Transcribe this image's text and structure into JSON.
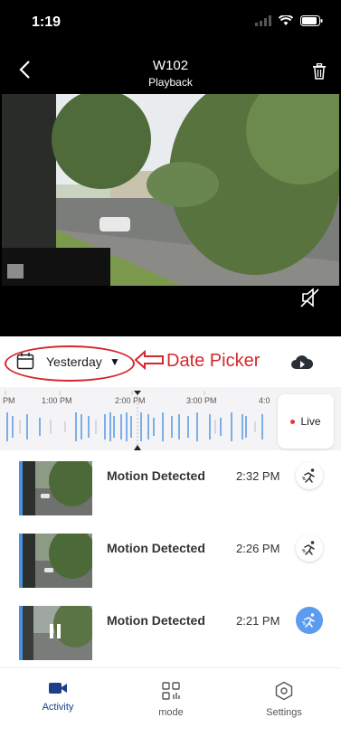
{
  "status_bar": {
    "time": "1:19"
  },
  "header": {
    "title": "W102",
    "subtitle": "Playback"
  },
  "date_picker": {
    "label": "Yesterday",
    "annotation": "Date Picker"
  },
  "timeline": {
    "labels": [
      "PM",
      "1:00 PM",
      "2:00 PM",
      "3:00 PM",
      "4:0"
    ],
    "live_label": "Live"
  },
  "events": [
    {
      "title": "Motion Detected",
      "time": "2:32 PM",
      "icon": "running-person-icon",
      "active": false
    },
    {
      "title": "Motion Detected",
      "time": "2:26 PM",
      "icon": "running-person-icon",
      "active": false
    },
    {
      "title": "Motion Detected",
      "time": "2:21 PM",
      "icon": "running-person-icon",
      "active": true
    }
  ],
  "tabs": [
    {
      "label": "Activity",
      "icon": "video-camera-icon",
      "active": true
    },
    {
      "label": "mode",
      "icon": "grid-icon",
      "active": false
    },
    {
      "label": "Settings",
      "icon": "hexagon-gear-icon",
      "active": false
    }
  ],
  "colors": {
    "accent": "#4a90e2",
    "annotation": "#d7262e",
    "active_tab": "#1c3f8a",
    "live_dot": "#e53935"
  }
}
